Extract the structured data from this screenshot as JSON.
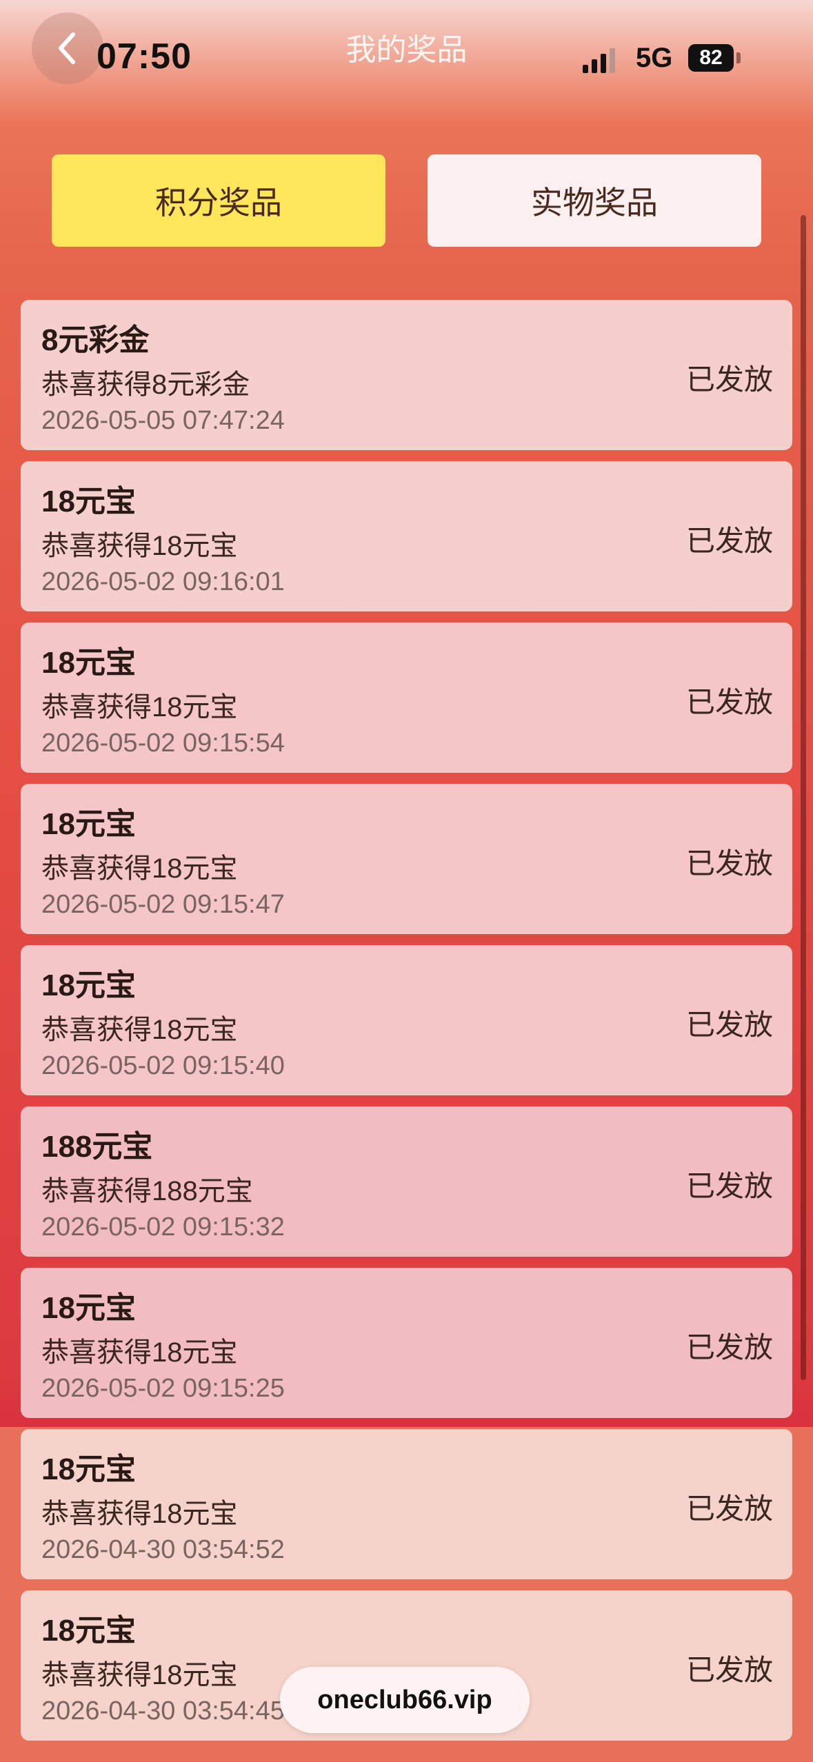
{
  "status_bar": {
    "time": "07:50",
    "network": "5G",
    "battery": "82"
  },
  "header": {
    "title": "我的奖品"
  },
  "tabs": [
    {
      "label": "积分奖品",
      "active": true
    },
    {
      "label": "实物奖品",
      "active": false
    }
  ],
  "prizes": [
    {
      "name": "8元彩金",
      "description": "恭喜获得8元彩金",
      "time": "2026-05-05 07:47:24",
      "status": "已发放"
    },
    {
      "name": "18元宝",
      "description": "恭喜获得18元宝",
      "time": "2026-05-02 09:16:01",
      "status": "已发放"
    },
    {
      "name": "18元宝",
      "description": "恭喜获得18元宝",
      "time": "2026-05-02 09:15:54",
      "status": "已发放"
    },
    {
      "name": "18元宝",
      "description": "恭喜获得18元宝",
      "time": "2026-05-02 09:15:47",
      "status": "已发放"
    },
    {
      "name": "18元宝",
      "description": "恭喜获得18元宝",
      "time": "2026-05-02 09:15:40",
      "status": "已发放"
    },
    {
      "name": "188元宝",
      "description": "恭喜获得188元宝",
      "time": "2026-05-02 09:15:32",
      "status": "已发放"
    },
    {
      "name": "18元宝",
      "description": "恭喜获得18元宝",
      "time": "2026-05-02 09:15:25",
      "status": "已发放"
    },
    {
      "name": "18元宝",
      "description": "恭喜获得18元宝",
      "time": "2026-04-30 03:54:52",
      "status": "已发放"
    },
    {
      "name": "18元宝",
      "description": "恭喜获得18元宝",
      "time": "2026-04-30 03:54:45",
      "status": "已发放"
    }
  ],
  "site_pill": {
    "label": "oneclub66.vip"
  },
  "colors": {
    "active_tab": "#fde65a",
    "inactive_tab": "#fbf0ef",
    "card": "#f4cfcc",
    "header_gradient_top": "#f7d7d2",
    "background_red": "#dc3a3f"
  },
  "icons": {
    "back": "chevron-left-icon",
    "signal": "cellular-signal-icon",
    "battery": "battery-icon"
  }
}
